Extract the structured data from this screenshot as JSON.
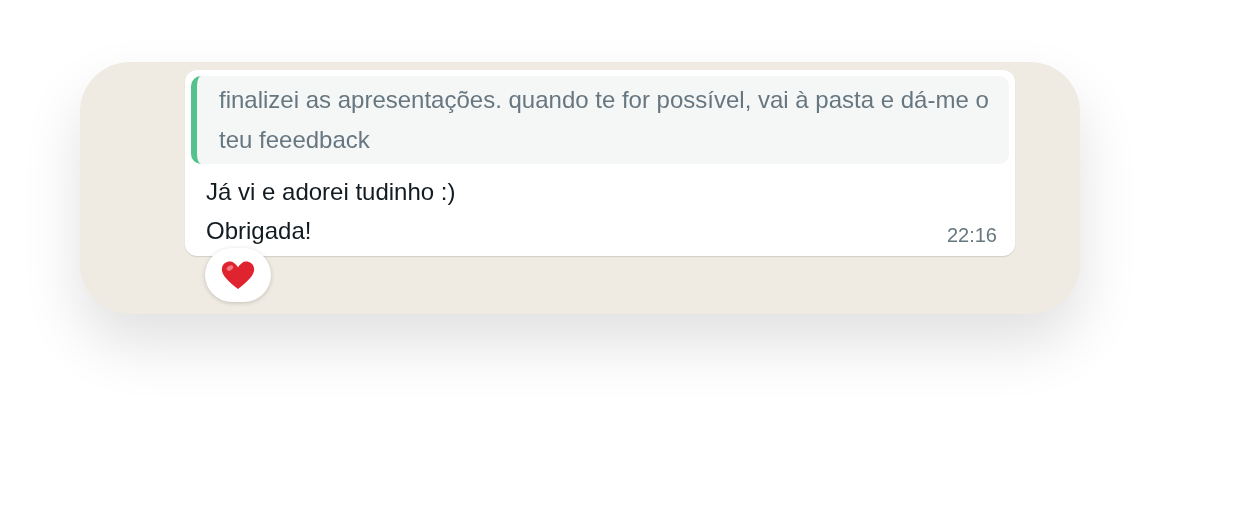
{
  "message": {
    "quote": {
      "text": "finalizei as apresentações. quando te for possível, vai à pasta e dá-me o teu feeedback"
    },
    "lines": [
      "Já vi e adorei tudinho :)",
      "Obrigada!"
    ],
    "time": "22:16",
    "reaction": {
      "kind": "heart"
    }
  }
}
